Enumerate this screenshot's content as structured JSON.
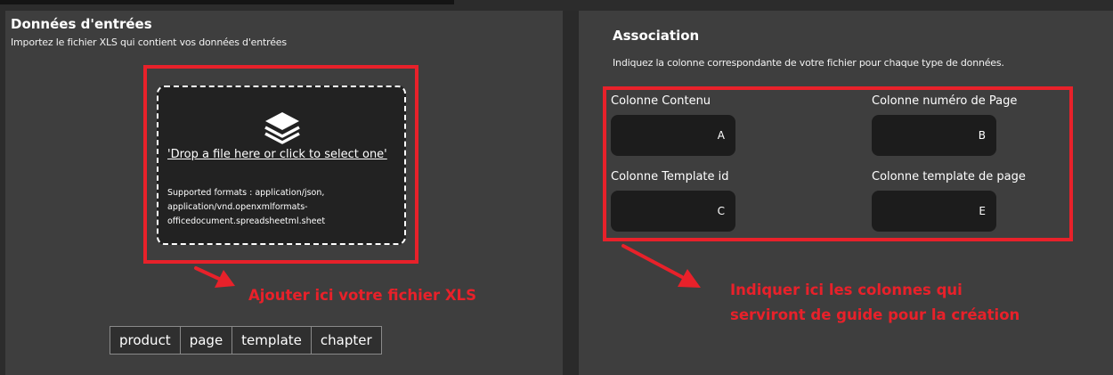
{
  "left_panel": {
    "title": "Données d'entrées",
    "subtitle": "Importez le fichier XLS qui contient vos données d'entrées",
    "dropzone": {
      "icon": "layers-icon",
      "link_text": "'Drop a file here or click to select one'",
      "formats": "Supported formats : application/json, application/vnd.openxmlformats-officedocument.spreadsheetml.sheet"
    },
    "annotation": "Ajouter ici votre fichier XLS",
    "tags": [
      "product",
      "page",
      "template",
      "chapter"
    ]
  },
  "right_panel": {
    "title": "Association",
    "subtitle": "Indiquez la colonne correspondante de votre fichier pour chaque type de données.",
    "fields": {
      "contenu": {
        "label": "Colonne Contenu",
        "value": "A"
      },
      "numero_page": {
        "label": "Colonne numéro de Page",
        "value": "B"
      },
      "template_id": {
        "label": "Colonne Template id",
        "value": "C"
      },
      "template_page": {
        "label": "Colonne template de page",
        "value": "E"
      }
    },
    "annotation_line1": "Indiquer ici les colonnes qui",
    "annotation_line2": "serviront de guide pour la création"
  },
  "colors": {
    "annotation_red": "#e8212a",
    "panel_bg": "#3e3e3e",
    "input_bg": "#1c1c1c"
  }
}
